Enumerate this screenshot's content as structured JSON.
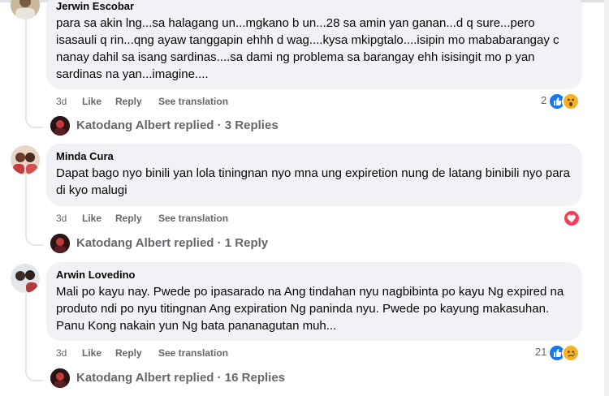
{
  "comments": [
    {
      "author": "Jerwin Escobar",
      "text": "para sa akin lng...sa halagang un...mgkano b un...28 sa amin yan ganan...d q sure...pero isasauli q rin...qng ayaw tanggapin ehhh d wag....kysa mkipgtalo....isipin mo mababarangay c nanay dahil sa isang sardinas....sa dami ng problema sa barangay ehh isisingit mo p yan sardinas na yan...imagine....",
      "time": "3d",
      "like": "Like",
      "reply": "Reply",
      "translate": "See translation",
      "reaction_count": "2",
      "reactions": [
        "like-icon",
        "wow-icon"
      ],
      "replies_author": "Katodang Albert",
      "replies_text": "Katodang Albert replied · 3 Replies"
    },
    {
      "author": "Minda Cura",
      "text": "Dapat bago nyo binili yan lola tiningnan nyo mna ung expiretion nung de latang binibili nyo para di kyo malugi",
      "time": "3d",
      "like": "Like",
      "reply": "Reply",
      "translate": "See translation",
      "reaction_count": "",
      "reactions": [
        "love-icon"
      ],
      "replies_author": "Katodang Albert",
      "replies_text": "Katodang Albert replied · 1 Reply"
    },
    {
      "author": "Arwin Lovedino",
      "text": "Mali po kayu nay. Pwede po ipasarado na Ang tindahan nyu nagbibinta po kayu Ng expired na produto ndi po nyu titingnan Ang expiration Ng paninda nyu. Pwede po kayung makasuhan. Panu Kong nakain yun Ng bata pananagutan muh...",
      "time": "3d",
      "like": "Like",
      "reply": "Reply",
      "translate": "See translation",
      "reaction_count": "21",
      "reactions": [
        "like-icon",
        "sad-icon"
      ],
      "replies_author": "Katodang Albert",
      "replies_text": "Katodang Albert replied · 16 Replies"
    }
  ],
  "colors": {
    "bubble": "#f0f2f5",
    "meta": "#65676b",
    "like_blue": "#1877f2",
    "love_red": "#f33e58",
    "wow_yellow": "#f7b125"
  }
}
